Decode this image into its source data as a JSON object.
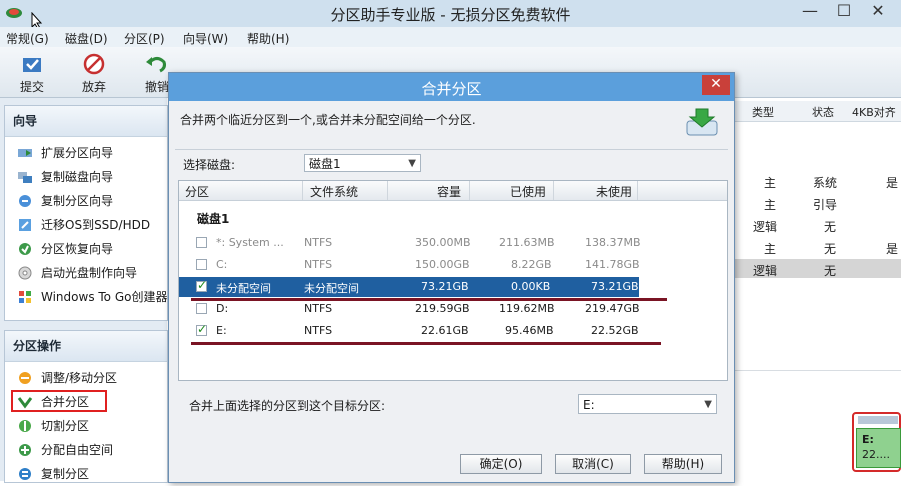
{
  "window": {
    "title": "分区助手专业版 - 无损分区免费软件",
    "minimize": "—",
    "restore": "☐",
    "close": "✕"
  },
  "menu": [
    "常规(G)",
    "磁盘(D)",
    "分区(P)",
    "向导(W)",
    "帮助(H)"
  ],
  "toolbar": {
    "submit": "提交",
    "discard": "放弃",
    "undo": "撤销"
  },
  "wizard_section": {
    "title": "向导",
    "items": [
      {
        "label": "扩展分区向导",
        "icon": "extend-partition-icon"
      },
      {
        "label": "复制磁盘向导",
        "icon": "copy-disk-icon"
      },
      {
        "label": "复制分区向导",
        "icon": "copy-partition-icon"
      },
      {
        "label": "迁移OS到SSD/HDD",
        "icon": "migrate-os-icon"
      },
      {
        "label": "分区恢复向导",
        "icon": "recovery-icon"
      },
      {
        "label": "启动光盘制作向导",
        "icon": "boot-cd-icon"
      },
      {
        "label": "Windows To Go创建器",
        "icon": "windows-icon"
      }
    ]
  },
  "ops_section": {
    "title": "分区操作",
    "items": [
      {
        "label": "调整/移动分区",
        "icon": "resize-icon"
      },
      {
        "label": "合并分区",
        "icon": "merge-icon"
      },
      {
        "label": "切割分区",
        "icon": "split-icon"
      },
      {
        "label": "分配自由空间",
        "icon": "allocate-icon"
      },
      {
        "label": "复制分区",
        "icon": "copy-icon"
      }
    ]
  },
  "right_table": {
    "headers": [
      "类型",
      "状态",
      "4KB对齐"
    ],
    "rows": [
      [
        "主",
        "系统",
        "是"
      ],
      [
        "主",
        "引导",
        ""
      ],
      [
        "逻辑",
        "无",
        ""
      ],
      [
        "主",
        "无",
        "是"
      ],
      [
        "逻辑",
        "无",
        ""
      ]
    ]
  },
  "disk_map": {
    "label": "E:",
    "value": "22...."
  },
  "dialog": {
    "title": "合并分区",
    "close": "✕",
    "description": "合并两个临近分区到一个,或合并未分配空间给一个分区.",
    "select_disk_label": "选择磁盘:",
    "select_disk_value": "磁盘1",
    "columns": [
      "分区",
      "文件系统",
      "容量",
      "已使用",
      "未使用"
    ],
    "disk_group": "磁盘1",
    "rows": [
      {
        "name": "*: System ...",
        "fs": "NTFS",
        "capacity": "350.00MB",
        "used": "211.63MB",
        "free": "138.37MB",
        "checked": false,
        "state": "grey"
      },
      {
        "name": "C:",
        "fs": "NTFS",
        "capacity": "150.00GB",
        "used": "8.22GB",
        "free": "141.78GB",
        "checked": false,
        "state": "grey"
      },
      {
        "name": "未分配空间",
        "fs": "未分配空间",
        "capacity": "73.21GB",
        "used": "0.00KB",
        "free": "73.21GB",
        "checked": true,
        "state": "selected"
      },
      {
        "name": "D:",
        "fs": "NTFS",
        "capacity": "219.59GB",
        "used": "119.62MB",
        "free": "219.47GB",
        "checked": false,
        "state": "normal"
      },
      {
        "name": "E:",
        "fs": "NTFS",
        "capacity": "22.61GB",
        "used": "95.46MB",
        "free": "22.52GB",
        "checked": true,
        "state": "normal"
      }
    ],
    "target_label": "合并上面选择的分区到这个目标分区:",
    "target_value": "E:",
    "buttons": {
      "ok": "确定(O)",
      "cancel": "取消(C)",
      "help": "帮助(H)"
    }
  }
}
